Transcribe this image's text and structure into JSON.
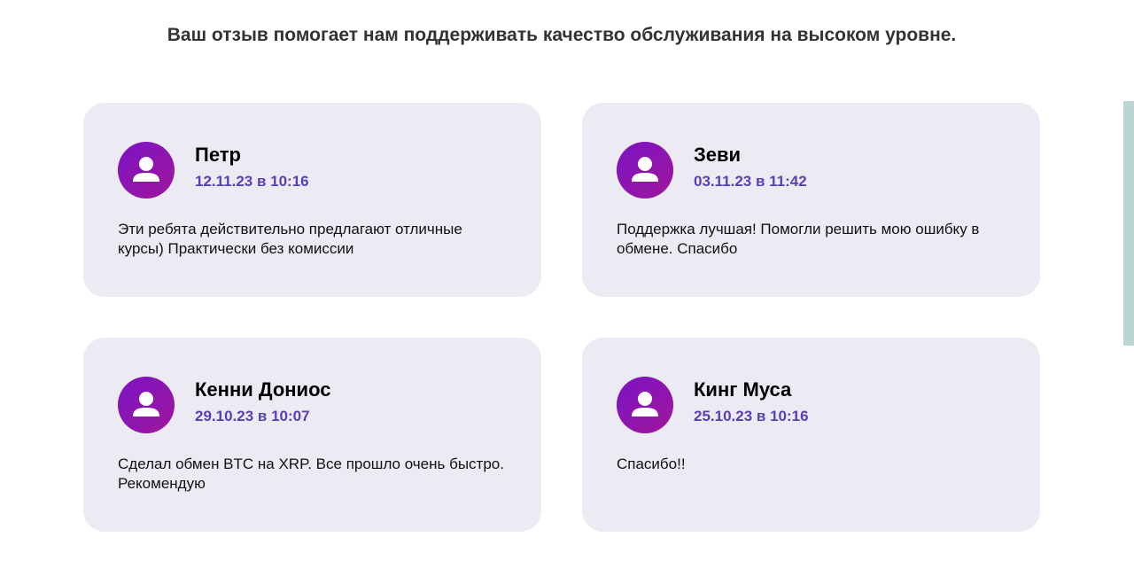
{
  "heading": "Ваш отзыв помогает нам поддерживать качество обслуживания на высоком уровне.",
  "colors": {
    "card_background": "#ecebf4",
    "date_color": "#5a3fb3",
    "avatar_gradient_start": "#7a14c6",
    "avatar_gradient_end": "#a0169a",
    "scroll_strip": "#b9d6d4"
  },
  "avatar_icon": "user-icon",
  "reviews": [
    {
      "name": "Петр",
      "date": "12.11.23 в 10:16",
      "text": "Эти ребята действительно предлагают отличные курсы) Практически без комиссии"
    },
    {
      "name": "Зеви",
      "date": "03.11.23 в 11:42",
      "text": "Поддержка лучшая! Помогли решить мою ошибку в обмене. Спасибо"
    },
    {
      "name": "Кенни Дониос",
      "date": "29.10.23 в 10:07",
      "text": "Сделал обмен BTC на XRP. Все прошло очень быстро. Рекомендую"
    },
    {
      "name": "Кинг Муса",
      "date": "25.10.23 в 10:16",
      "text": "Спасибо!!"
    }
  ]
}
